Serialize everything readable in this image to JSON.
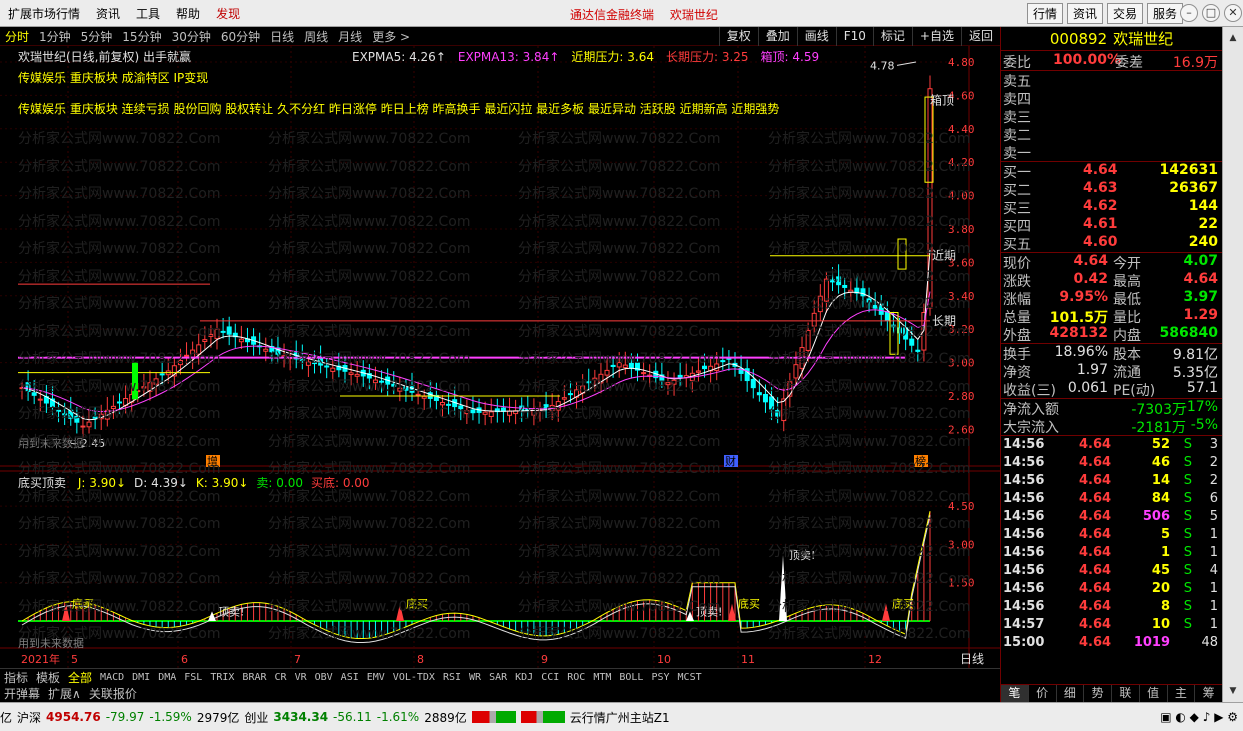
{
  "menu": {
    "items": [
      "扩展市场行情",
      "资讯",
      "工具",
      "帮助"
    ],
    "highlight": "发现",
    "promo": [
      "通达信金融终端",
      "欢瑞世纪"
    ],
    "right_buttons": [
      "行情",
      "资讯",
      "交易",
      "服务"
    ]
  },
  "toolbar": {
    "periods": [
      "分时",
      "1分钟",
      "5分钟",
      "15分钟",
      "30分钟",
      "60分钟",
      "日线",
      "周线",
      "月线",
      "更多 >"
    ],
    "buttons": [
      "复权",
      "叠加",
      "画线",
      "F10",
      "标记",
      "+自选",
      "返回"
    ]
  },
  "price_chart": {
    "header": "欢瑞世纪(日线,前复权) 出手就赢",
    "indicators": [
      {
        "label": "EXPMA5: 4.26",
        "arrow": "↑",
        "color": "#e0e0e0"
      },
      {
        "label": "EXPMA13: 3.84",
        "arrow": "↑",
        "color": "#ff40ff"
      },
      {
        "label": "近期压力: 3.64",
        "arrow": "",
        "color": "#ffff00"
      },
      {
        "label": "长期压力: 3.25",
        "arrow": "",
        "color": "#ff3c3c"
      },
      {
        "label": "箱顶: 4.59",
        "arrow": "",
        "color": "#ff40ff"
      }
    ],
    "concepts_line1": "传媒娱乐 重庆板块 成渝特区 IP变现",
    "concepts_line2": "传媒娱乐 重庆板块 连续亏损 股份回购 股权转让 久不分红 昨日涨停 昨日上榜 昨高换手 最近闪拉 最近多板 最近异动 活跃股 近期新高 近期强势",
    "y_ticks": [
      "4.80",
      "4.60",
      "4.40",
      "4.20",
      "4.00",
      "3.80",
      "3.60",
      "3.40",
      "3.20",
      "3.00",
      "2.80",
      "2.60"
    ],
    "high_label": "4.78",
    "low_label": "2.45",
    "future_label": "用到未来数据",
    "right_labels": {
      "box": "箱顶",
      "near": "近期",
      "long": "长期"
    },
    "markers": {
      "zeng": "增",
      "cai": "财",
      "bang": "榜"
    }
  },
  "sub_chart": {
    "name": "底买顶卖",
    "values": [
      {
        "label": "J: 3.90",
        "arrow": "↓",
        "color": "#ffff00"
      },
      {
        "label": "D: 4.39",
        "arrow": "↓",
        "color": "#e0e0e0"
      },
      {
        "label": "K: 3.90",
        "arrow": "↓",
        "color": "#ffff00"
      },
      {
        "label": "卖: 0.00",
        "arrow": "",
        "color": "#00e600"
      },
      {
        "label": "买底: 0.00",
        "arrow": "",
        "color": "#ff3c3c"
      }
    ],
    "y_ticks": [
      "4.50",
      "3.00",
      "1.50"
    ],
    "signals": {
      "buy": "底买",
      "sell": "顶卖!"
    },
    "future_label": "用到未来数据"
  },
  "date_axis": {
    "labels": [
      "2021年",
      "5",
      "6",
      "7",
      "8",
      "9",
      "10",
      "11",
      "12"
    ],
    "period": "日线"
  },
  "indicator_tabs": {
    "first": [
      "指标",
      "模板",
      "全部"
    ],
    "items": [
      "MACD",
      "DMI",
      "DMA",
      "FSL",
      "TRIX",
      "BRAR",
      "CR",
      "VR",
      "OBV",
      "ASI",
      "EMV",
      "VOL-TDX",
      "RSI",
      "WR",
      "SAR",
      "KDJ",
      "CCI",
      "ROC",
      "MTM",
      "BOLL",
      "PSY",
      "MCST"
    ],
    "second_row": [
      "开弹幕",
      "扩展∧",
      "关联报价"
    ]
  },
  "quote": {
    "code": "000892",
    "name": "欢瑞世纪",
    "weibi_label": "委比",
    "weibi": "100.00%",
    "weicha_label": "委差",
    "weicha": "16.9万",
    "asks": [
      "卖五",
      "卖四",
      "卖三",
      "卖二",
      "卖一"
    ],
    "bids": [
      {
        "label": "买一",
        "price": "4.64",
        "vol": "142631"
      },
      {
        "label": "买二",
        "price": "4.63",
        "vol": "26367"
      },
      {
        "label": "买三",
        "price": "4.62",
        "vol": "144"
      },
      {
        "label": "买四",
        "price": "4.61",
        "vol": "22"
      },
      {
        "label": "买五",
        "price": "4.60",
        "vol": "240"
      }
    ],
    "stats": [
      {
        "l1": "现价",
        "v1": "4.64",
        "c1": "red",
        "l2": "今开",
        "v2": "4.07",
        "c2": "grn"
      },
      {
        "l1": "涨跌",
        "v1": "0.42",
        "c1": "red",
        "l2": "最高",
        "v2": "4.64",
        "c2": "red"
      },
      {
        "l1": "涨幅",
        "v1": "9.95%",
        "c1": "red",
        "l2": "最低",
        "v2": "3.97",
        "c2": "grn"
      },
      {
        "l1": "总量",
        "v1": "101.5万",
        "c1": "yel",
        "l2": "量比",
        "v2": "1.29",
        "c2": "red"
      },
      {
        "l1": "外盘",
        "v1": "428132",
        "c1": "red",
        "l2": "内盘",
        "v2": "586840",
        "c2": "grn"
      }
    ],
    "stats2": [
      {
        "l1": "换手",
        "v1": "18.96%",
        "l2": "股本",
        "v2": "9.81亿"
      },
      {
        "l1": "净资",
        "v1": "1.97",
        "l2": "流通",
        "v2": "5.35亿"
      },
      {
        "l1": "收益(三)",
        "v1": "0.061",
        "l2": "PE(动)",
        "v2": "57.1"
      }
    ],
    "flow": [
      {
        "label": "净流入额",
        "amount": "-7303万",
        "pct": "-17%"
      },
      {
        "label": "大宗流入",
        "amount": "-2181万",
        "pct": "-5%"
      }
    ]
  },
  "ticks": [
    {
      "t": "14:56",
      "p": "4.64",
      "v": "52",
      "vc": "yel",
      "s": "S",
      "n": "3"
    },
    {
      "t": "14:56",
      "p": "4.64",
      "v": "46",
      "vc": "yel",
      "s": "S",
      "n": "2"
    },
    {
      "t": "14:56",
      "p": "4.64",
      "v": "14",
      "vc": "yel",
      "s": "S",
      "n": "2"
    },
    {
      "t": "14:56",
      "p": "4.64",
      "v": "84",
      "vc": "yel",
      "s": "S",
      "n": "6"
    },
    {
      "t": "14:56",
      "p": "4.64",
      "v": "506",
      "vc": "mag",
      "s": "S",
      "n": "5"
    },
    {
      "t": "14:56",
      "p": "4.64",
      "v": "5",
      "vc": "yel",
      "s": "S",
      "n": "1"
    },
    {
      "t": "14:56",
      "p": "4.64",
      "v": "1",
      "vc": "yel",
      "s": "S",
      "n": "1"
    },
    {
      "t": "14:56",
      "p": "4.64",
      "v": "45",
      "vc": "yel",
      "s": "S",
      "n": "4"
    },
    {
      "t": "14:56",
      "p": "4.64",
      "v": "20",
      "vc": "yel",
      "s": "S",
      "n": "1"
    },
    {
      "t": "14:56",
      "p": "4.64",
      "v": "8",
      "vc": "yel",
      "s": "S",
      "n": "1"
    },
    {
      "t": "14:57",
      "p": "4.64",
      "v": "10",
      "vc": "yel",
      "s": "S",
      "n": "1"
    },
    {
      "t": "15:00",
      "p": "4.64",
      "v": "1019",
      "vc": "mag",
      "s": "",
      "n": "48"
    }
  ],
  "right_tabs": [
    "笔",
    "价",
    "细",
    "势",
    "联",
    "值",
    "主",
    "筹"
  ],
  "status": {
    "prefix": "亿",
    "sh_label": "沪深",
    "sh_val": "4954.76",
    "sh_chg": "-79.97",
    "sh_pct": "-1.59%",
    "sh_amt": "2979亿",
    "cy_label": "创业",
    "cy_val": "3434.34",
    "cy_chg": "-56.11",
    "cy_pct": "-1.61%",
    "cy_amt": "2889亿",
    "server": "云行情广州主站Z1"
  },
  "watermark": "分析家公式网www.70822.Com",
  "colors": {
    "up": "#ff3c3c",
    "down": "#00ffff",
    "ema5": "#ffffff",
    "ema13": "#ff40ff",
    "near": "#ffff00",
    "long": "#ff3c3c",
    "box": "#ff40ff"
  }
}
